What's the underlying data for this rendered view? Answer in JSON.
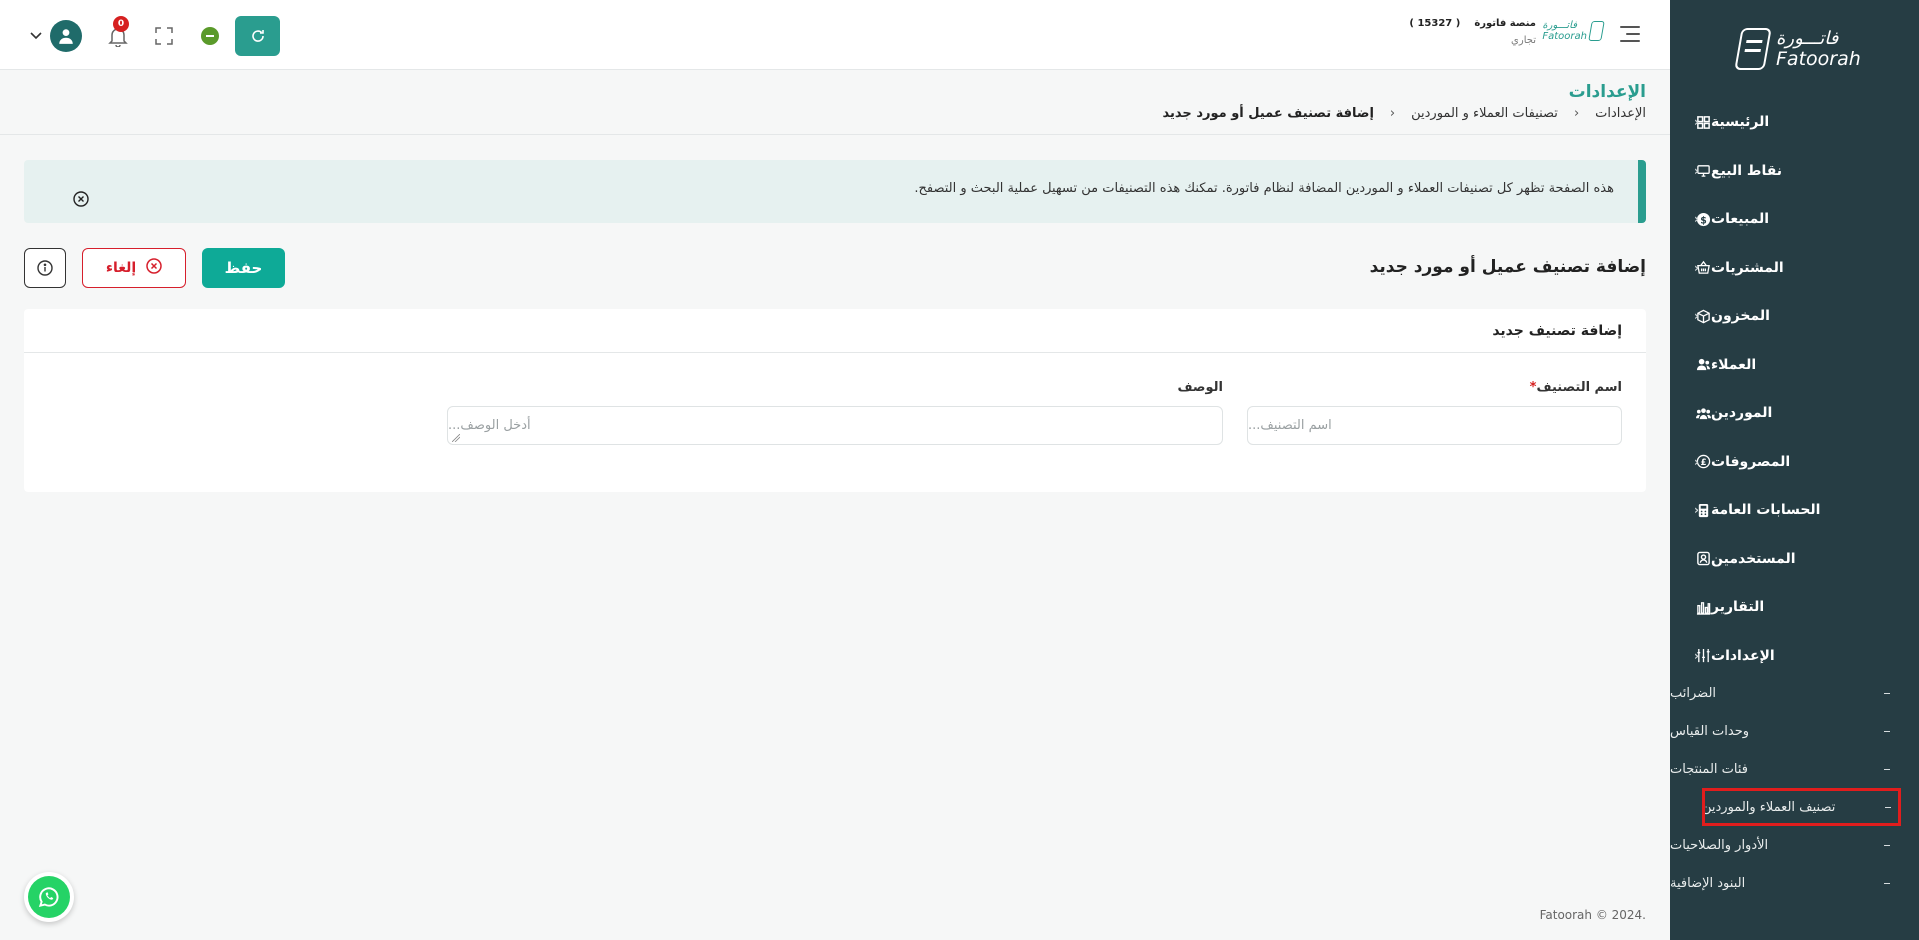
{
  "brand": {
    "name_ar": "فاتـــورة",
    "name_en": "Fatoorah"
  },
  "topbar": {
    "company_name": "منصة فاتورة",
    "company_id": "( 15327 )",
    "company_type": "تجاري",
    "notifications_count": "0"
  },
  "sidebar": {
    "items": [
      {
        "label": "الرئيسية",
        "icon": "grid-icon",
        "has_children": true
      },
      {
        "label": "نقاط البيع",
        "icon": "monitor-icon",
        "has_children": true
      },
      {
        "label": "المبيعات",
        "icon": "dollar-icon",
        "has_children": true
      },
      {
        "label": "المشتريات",
        "icon": "basket-icon",
        "has_children": true
      },
      {
        "label": "المخزون",
        "icon": "box-icon",
        "has_children": true
      },
      {
        "label": "العملاء",
        "icon": "users-icon",
        "has_children": false
      },
      {
        "label": "الموردين",
        "icon": "group-icon",
        "has_children": false
      },
      {
        "label": "المصروفات",
        "icon": "coin-icon",
        "has_children": true
      },
      {
        "label": "الحسابات العامة",
        "icon": "calculator-icon",
        "has_children": true
      },
      {
        "label": "المستخدمين",
        "icon": "user-card-icon",
        "has_children": false
      },
      {
        "label": "التقارير",
        "icon": "chart-icon",
        "has_children": false
      },
      {
        "label": "الإعدادات",
        "icon": "sliders-icon",
        "has_children": true,
        "expanded": true
      }
    ],
    "sub_items": [
      {
        "label": "الضرائب"
      },
      {
        "label": "وحدات القياس"
      },
      {
        "label": "فئات المنتجات"
      },
      {
        "label": "تصنيف العملاء والموردين",
        "active": true
      },
      {
        "label": "الأدوار والصلاحيات"
      },
      {
        "label": "البنود الإضافية"
      }
    ]
  },
  "page": {
    "title": "الإعدادات",
    "breadcrumb": [
      "الإعدادات",
      "تصنيفات العملاء و الموردين",
      "إضافة تصنيف عميل أو مورد جديد"
    ],
    "alert_text": "هذه الصفحة تظهر كل تصنيفات العملاء و الموردين المضافة لنظام فاتورة. تمكنك هذه التصنيفات من تسهيل عملية البحث و التصفح.",
    "form_title": "إضافة تصنيف عميل أو مورد جديد",
    "save_label": "حفظ",
    "cancel_label": "إلغاء",
    "card_title": "إضافة تصنيف جديد",
    "fields": {
      "name_label": "اسم التصنيف",
      "name_placeholder": "اسم التصنيف...",
      "desc_label": "الوصف",
      "desc_placeholder": "أدخل الوصف..."
    },
    "footer": "Fatoorah © 2024."
  },
  "colors": {
    "sidebar": "#263d44",
    "accent": "#2a9d8f",
    "save": "#0eaa97",
    "danger": "#d61f2c"
  }
}
